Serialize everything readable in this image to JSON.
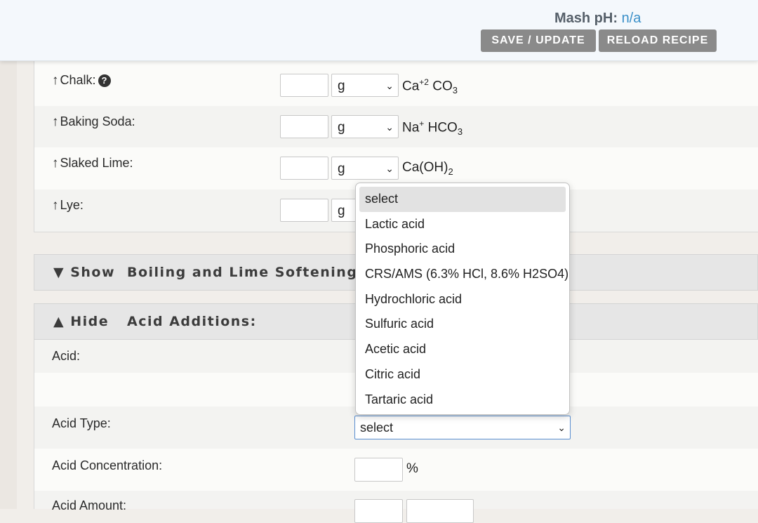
{
  "header": {
    "mash_ph_label": "Mash pH:",
    "mash_ph_value": "n/a",
    "save_label": "SAVE / UPDATE",
    "reload_label": "RELOAD RECIPE"
  },
  "alkaline": [
    {
      "label": "Chalk:",
      "unit": "g",
      "formula_html": "Ca<sup>+2</sup> CO<sub>3</sub>",
      "help": true
    },
    {
      "label": "Baking Soda:",
      "unit": "g",
      "formula_html": "Na<sup>+</sup> HCO<sub>3</sub>"
    },
    {
      "label": "Slaked Lime:",
      "unit": "g",
      "formula_html": "Ca(OH)<sub>2</sub>"
    },
    {
      "label": "Lye:",
      "unit": "g",
      "formula_html": ""
    }
  ],
  "arrow": "↑",
  "help_glyph": "?",
  "sections": {
    "boiling": {
      "toggle": "▼ Show",
      "title": "Boiling and Lime Softening:"
    },
    "acid": {
      "toggle": "▲ Hide",
      "title": "Acid Additions:"
    }
  },
  "acid": {
    "acid_label": "Acid:",
    "type_label": "Acid Type:",
    "type_value": "select",
    "concentration_label": "Acid Concentration:",
    "percent": "%",
    "amount_label": "Acid Amount:"
  },
  "dropdown": {
    "options": [
      "select",
      "Lactic acid",
      "Phosphoric acid",
      "CRS/AMS (6.3% HCl, 8.6% H2SO4)",
      "Hydrochloric acid",
      "Sulfuric acid",
      "Acetic acid",
      "Citric acid",
      "Tartaric acid"
    ],
    "highlighted": 0
  }
}
